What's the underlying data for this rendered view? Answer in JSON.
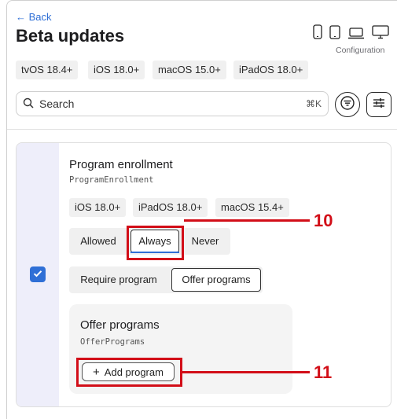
{
  "header": {
    "back_label": "← Back",
    "title": "Beta updates",
    "configuration_label": "Configuration",
    "device_icons": [
      "phone-icon",
      "tablet-icon",
      "laptop-icon",
      "desktop-icon"
    ]
  },
  "platform_tags": [
    "tvOS 18.4+",
    "iOS 18.0+",
    "macOS 15.0+",
    "iPadOS 18.0+"
  ],
  "search": {
    "placeholder": "Search",
    "shortcut": "⌘K"
  },
  "setting": {
    "name": "Program enrollment",
    "key": "ProgramEnrollment",
    "tags": [
      "iOS 18.0+",
      "iPadOS 18.0+",
      "macOS 15.4+"
    ],
    "enrollment_options": [
      "Allowed",
      "Always",
      "Never"
    ],
    "enrollment_selected": "Always",
    "program_options": [
      "Require program",
      "Offer programs"
    ],
    "program_selected": "Offer programs",
    "enabled": true
  },
  "subsetting": {
    "name": "Offer programs",
    "key": "OfferPrograms",
    "add_button_label": "Add program"
  },
  "annotations": {
    "callout_always": "10",
    "callout_add_program": "11",
    "color": "#d20e18"
  },
  "colors": {
    "accent": "#2f6fd6",
    "checkbox": "#2f6fd6",
    "strip": "#eeeefa"
  }
}
